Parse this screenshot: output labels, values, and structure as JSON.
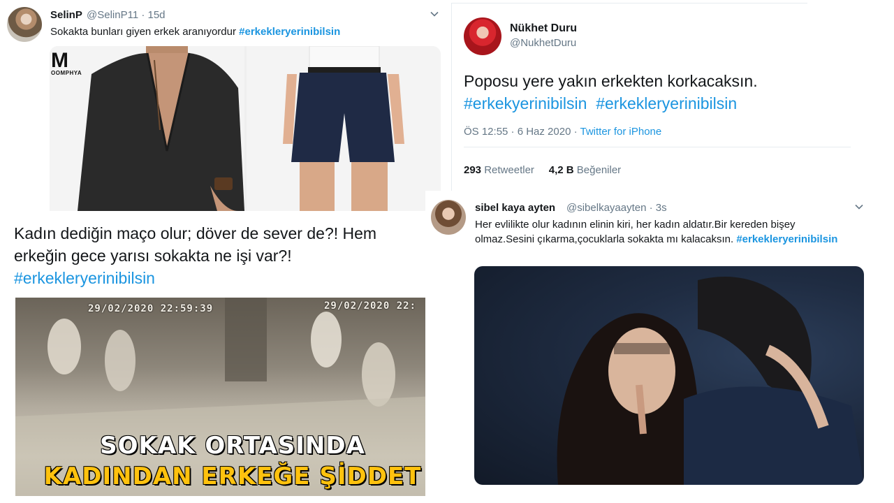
{
  "tweet1": {
    "display_name": "SelinP",
    "handle_time": "@SelinP11 · 15d",
    "text": "Sokakta bunları giyen erkek aranıyordur ",
    "hashtag": "#erkekleryerinibilsin",
    "media_logo_letter": "M",
    "media_logo_word": "OOMPHYA",
    "menu_icon": "chevron-down-icon"
  },
  "tweet2": {
    "display_name": "Nükhet Duru",
    "handle": "@NukhetDuru",
    "text": "Poposu yere yakın erkekten korkacaksın.",
    "hashtag_1": "#erkekyerinibilsin",
    "hashtag_2": "#erkekleryerinibilsin",
    "time": "ÖS 12:55 · 6 Haz 2020 · ",
    "source": "Twitter for iPhone",
    "retweets_count": "293",
    "retweets_label": "Retweetler",
    "likes_count": "4,2 B",
    "likes_label": "Beğeniler"
  },
  "tweet3": {
    "text_line1": "Kadın dediğin maço olur; döver de sever de?! Hem",
    "text_line2": "erkeğin gece yarısı sokakta ne işi var?!",
    "hashtag": "#erkekleryerinibilsin",
    "cctv_stamp_1": "29/02/2020 22:59:39",
    "cctv_stamp_2": "29/02/2020 22:",
    "headline_1": "SOKAK ORTASINDA",
    "headline_2": "KADINDAN ERKEĞE ŞİDDET"
  },
  "tweet4": {
    "display_name": "sibel kaya ayten",
    "handle_time": "@sibelkayaayten · 3s",
    "text": "Her evlilikte olur kadının elinin kiri, her kadın aldatır.Bir kereden bişey olmaz.Sesini çıkarma,çocuklarla sokakta mı kalacaksın. ",
    "hashtag": "#erkekleryerinibilsin",
    "menu_icon": "chevron-down-icon"
  },
  "colors": {
    "link": "#1b95e0",
    "muted": "#657786",
    "text": "#14171a",
    "headline_yellow": "#ffc20e"
  }
}
